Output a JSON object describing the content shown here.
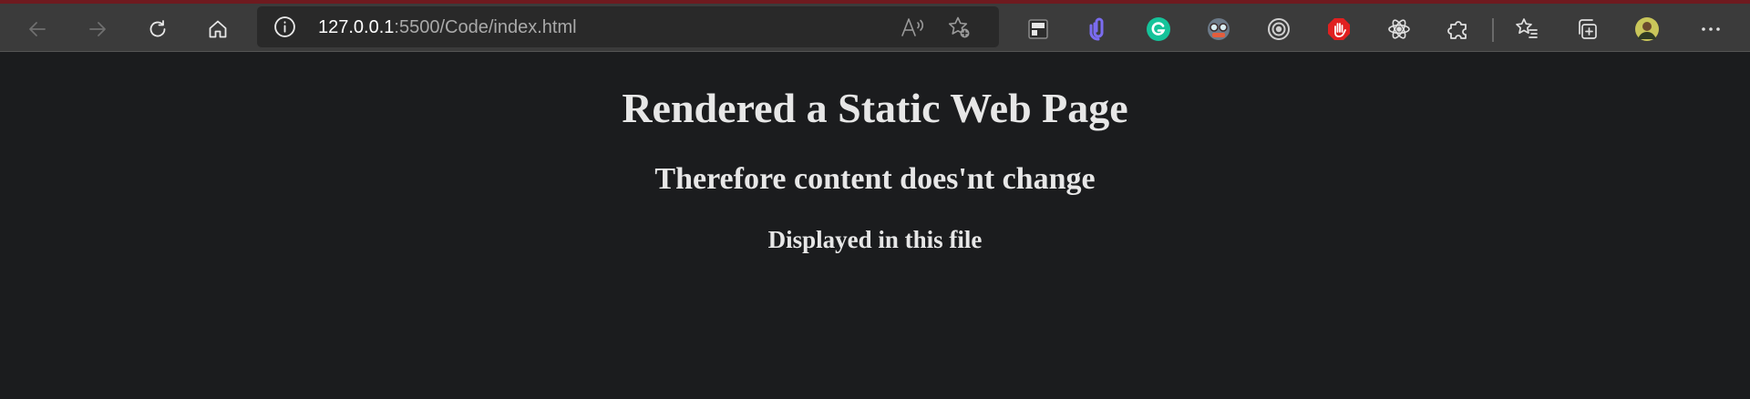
{
  "browser": {
    "address_bar": {
      "url_host": "127.0.0.1",
      "url_rest": ":5500/Code/index.html"
    },
    "nav_icons": [
      "back-icon",
      "forward-icon",
      "refresh-icon",
      "home-icon"
    ],
    "address_icons": [
      "site-info-icon",
      "read-aloud-icon",
      "add-favorite-icon"
    ],
    "extension_icons": [
      "sidebar-extension-icon",
      "link-extension-icon",
      "grammarly-icon",
      "glasses-extension-icon",
      "target-extension-icon",
      "stop-extension-icon",
      "react-devtools-icon",
      "extensions-puzzle-icon"
    ],
    "right_icons": [
      "favorites-icon",
      "collections-icon",
      "profile-avatar",
      "more-menu-icon"
    ],
    "colors": {
      "toolbar": "#3b3b3b",
      "page_background": "#1b1c1e",
      "heading_text": "#e7e7e7",
      "grammarly": "#15c39a",
      "stop_extension": "#e02020",
      "link_extension": "#7b6cf0"
    }
  },
  "page": {
    "h1": "Rendered a Static Web Page",
    "h2": "Therefore content does'nt change",
    "h3": "Displayed in this file"
  }
}
